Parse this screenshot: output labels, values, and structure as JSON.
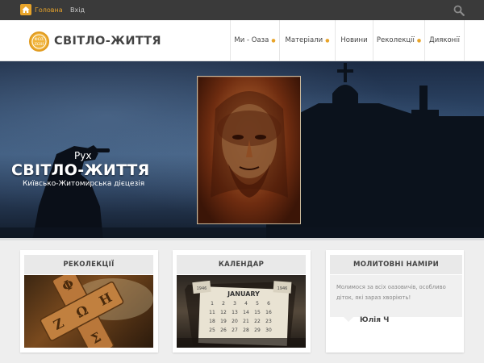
{
  "topbar": {
    "home_label": "Головна",
    "login_label": "Вхід"
  },
  "header": {
    "logo_text": "СВІТЛО-ЖИТТЯ",
    "nav": [
      {
        "label": "Ми - Оаза",
        "has_dropdown": true
      },
      {
        "label": "Матеріали",
        "has_dropdown": true
      },
      {
        "label": "Новини",
        "has_dropdown": false
      },
      {
        "label": "Реколекції",
        "has_dropdown": true
      },
      {
        "label": "Дияконії",
        "has_dropdown": false
      }
    ]
  },
  "hero": {
    "subtitle": "Рух",
    "title": "СВІТЛО-ЖИТТЯ",
    "diocese": "Київсько-Житомирська дієцезія"
  },
  "cards": {
    "retreats": {
      "title": "РЕКОЛЕКЦІЇ"
    },
    "calendar": {
      "title": "КАЛЕНДАР",
      "month": "JANUARY",
      "years": [
        "1946",
        "1946"
      ]
    },
    "prayer": {
      "title": "МОЛИТОВНІ НАМІРИ",
      "text": "Молимося за всіх оазовичів, особливо діток, які зараз хворіють!",
      "author": "Юлія Ч"
    }
  },
  "colors": {
    "accent": "#e8a42a",
    "topbar_bg": "#3a3a3a",
    "page_bg": "#eeeeee"
  },
  "icons": {
    "home": "home-icon",
    "search": "search-icon",
    "logo": "logo-icon",
    "dropdown": "caret-down-icon"
  }
}
